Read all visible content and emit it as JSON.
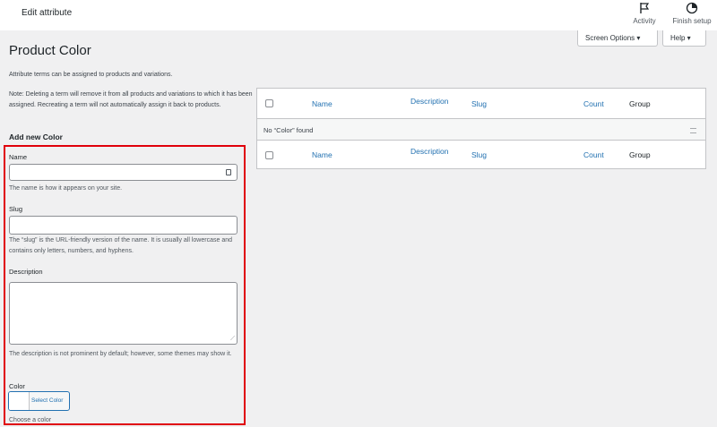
{
  "topbar": {
    "title": "Edit attribute",
    "activity_label": "Activity",
    "finish_setup_label": "Finish setup"
  },
  "screen_options": {
    "label": "Screen Options ▾"
  },
  "help": {
    "label": "Help ▾"
  },
  "page": {
    "title": "Product Color",
    "intro": "Attribute terms can be assigned to products and variations.",
    "note": "Note: Deleting a term will remove it from all products and variations to which it has been assigned. Recreating a term will not automatically assign it back to products."
  },
  "form": {
    "heading": "Add new Color",
    "name_label": "Name",
    "name_value": "",
    "name_hint": "The name is how it appears on your site.",
    "slug_label": "Slug",
    "slug_value": "",
    "slug_hint": "The “slug” is the URL-friendly version of the name. It is usually all lowercase and contains only letters, numbers, and hyphens.",
    "description_label": "Description",
    "description_value": "",
    "description_hint": "The description is not prominent by default; however, some themes may show it.",
    "color_label": "Color",
    "select_color": "Select Color",
    "color_hint": "Choose a color"
  },
  "table": {
    "columns": [
      "Name",
      "Description",
      "Slug",
      "Count",
      "Group"
    ],
    "empty_message": "No “Color” found"
  },
  "colors": {
    "highlight": "#e0000a",
    "link": "#2271b1"
  }
}
